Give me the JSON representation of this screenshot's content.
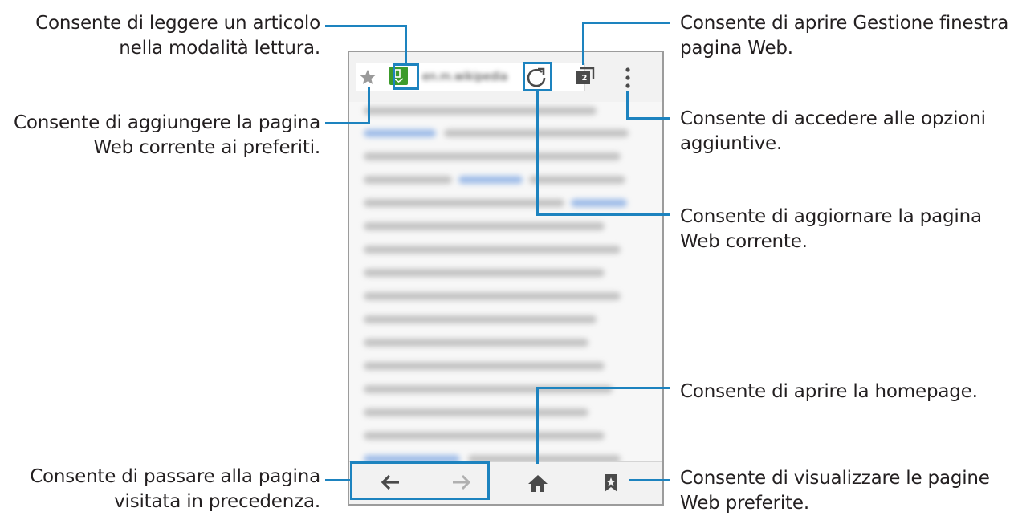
{
  "callouts": {
    "reader": [
      "Consente di leggere un articolo",
      "nella modalità lettura."
    ],
    "bookmark_add": [
      "Consente di aggiungere la pagina",
      "Web corrente ai preferiti."
    ],
    "back": [
      "Consente di passare alla pagina",
      "visitata in precedenza."
    ],
    "window_manager": [
      "Consente di aprire Gestione finestra",
      "pagina Web."
    ],
    "more_options": [
      "Consente di accedere alle opzioni",
      "aggiuntive."
    ],
    "refresh": [
      "Consente di aggiornare la pagina",
      "Web corrente."
    ],
    "home": [
      "Consente di aprire la homepage."
    ],
    "bookmarks": [
      "Consente di visualizzare le pagine",
      "Web preferite."
    ]
  },
  "browser": {
    "url_text": "en.m.wikipedia",
    "tabs_count": "2"
  },
  "colors": {
    "accent": "#1d83bf",
    "reader_icon": "#3c9b2b",
    "icon_gray": "#9a9a9a",
    "icon_dark": "#4a4a4a"
  },
  "icons": [
    "star-icon",
    "reader-mode-icon",
    "refresh-icon",
    "window-manager-icon",
    "more-options-icon",
    "back-arrow-icon",
    "forward-arrow-icon",
    "home-icon",
    "bookmarks-icon"
  ]
}
